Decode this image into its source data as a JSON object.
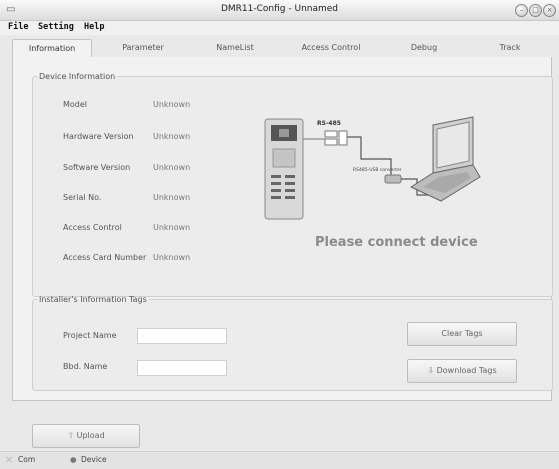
{
  "window": {
    "title": "DMR11-Config - Unnamed"
  },
  "menu": {
    "file": "File",
    "setting": "Setting",
    "help": "Help"
  },
  "tabs": [
    "Information",
    "Parameter",
    "NameList",
    "Access Control",
    "Debug",
    "Track"
  ],
  "device_info": {
    "legend": "Device Information",
    "rows": [
      {
        "label": "Model",
        "value": "Unknown"
      },
      {
        "label": "Hardware Version",
        "value": "Unknown"
      },
      {
        "label": "Software Version",
        "value": "Unknown"
      },
      {
        "label": "Serial No.",
        "value": "Unknown"
      },
      {
        "label": "Access Control",
        "value": "Unknown"
      },
      {
        "label": "Access Card Number",
        "value": "Unknown"
      }
    ]
  },
  "diagram": {
    "rs485_label": "RS-485",
    "converter_label": "RS485-USB converter",
    "connect_message": "Please connect device"
  },
  "installer": {
    "legend": "Installer's Information Tags",
    "project_label": "Project Name",
    "project_value": "",
    "bldg_label": "Bbd. Name",
    "bldg_value": "",
    "clear_button": "Clear Tags",
    "download_button": "Download Tags"
  },
  "upload_button": "Upload",
  "status": {
    "com": "Com",
    "device": "Device"
  }
}
